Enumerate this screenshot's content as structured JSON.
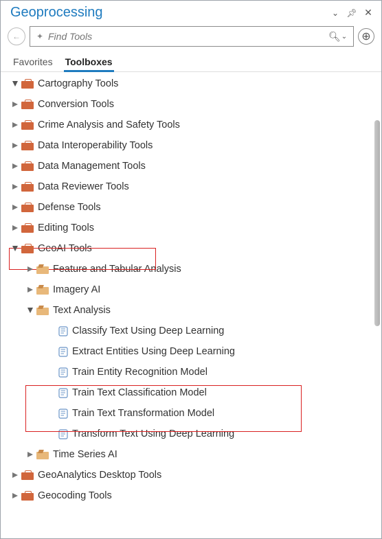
{
  "header": {
    "title": "Geoprocessing"
  },
  "search": {
    "placeholder": "Find Tools"
  },
  "tabs": {
    "favorites": "Favorites",
    "toolboxes": "Toolboxes"
  },
  "tree": {
    "cartography": "Cartography Tools",
    "conversion": "Conversion Tools",
    "crime": "Crime Analysis and Safety Tools",
    "interop": "Data Interoperability Tools",
    "datamgmt": "Data Management Tools",
    "reviewer": "Data Reviewer Tools",
    "defense": "Defense Tools",
    "editing": "Editing Tools",
    "geoai": "GeoAI Tools",
    "geoai_children": {
      "feature": "Feature and Tabular Analysis",
      "imagery": "Imagery AI",
      "text": "Text Analysis",
      "text_children": {
        "classify": "Classify Text Using Deep Learning",
        "extract": "Extract Entities Using Deep Learning",
        "train_entity": "Train Entity Recognition Model",
        "train_textclass": "Train Text Classification Model",
        "train_transform": "Train Text Transformation Model",
        "transform": "Transform Text Using Deep Learning"
      },
      "timeseries": "Time Series AI"
    },
    "geoanalytics": "GeoAnalytics Desktop Tools",
    "geocoding": "Geocoding Tools"
  }
}
